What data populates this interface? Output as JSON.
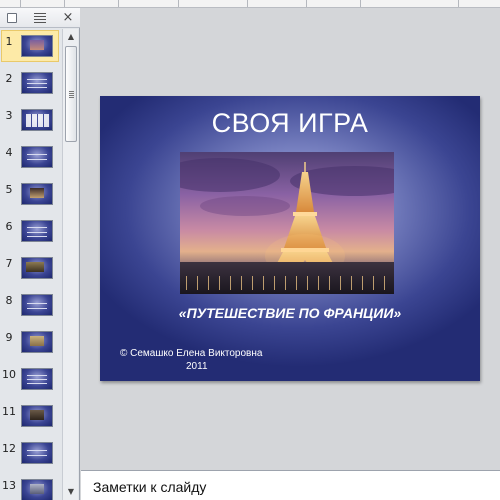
{
  "topstrip": {
    "description": ""
  },
  "left_panel": {
    "tabs": {
      "slides_icon": "slides-tab-icon",
      "outline_icon": "outline-tab-icon",
      "close_glyph": "×"
    },
    "thumbnails": [
      {
        "num": "1",
        "selected": true
      },
      {
        "num": "2"
      },
      {
        "num": "3"
      },
      {
        "num": "4"
      },
      {
        "num": "5"
      },
      {
        "num": "6"
      },
      {
        "num": "7"
      },
      {
        "num": "8"
      },
      {
        "num": "9"
      },
      {
        "num": "10"
      },
      {
        "num": "11"
      },
      {
        "num": "12"
      },
      {
        "num": "13"
      }
    ],
    "scroll": {
      "up_glyph": "▲",
      "down_glyph": "▼"
    }
  },
  "slide": {
    "title": "СВОЯ ИГРА",
    "subtitle": "«ПУТЕШЕСТВИЕ  ПО ФРАНЦИИ»",
    "credit_line1": "© Семашко Елена  Викторовна",
    "credit_line2": "2011"
  },
  "notes": {
    "placeholder": "Заметки к слайду"
  },
  "colors": {
    "slide_dark": "#232c74",
    "slide_light": "#c4c9ec",
    "selection": "#fdeaa7"
  }
}
